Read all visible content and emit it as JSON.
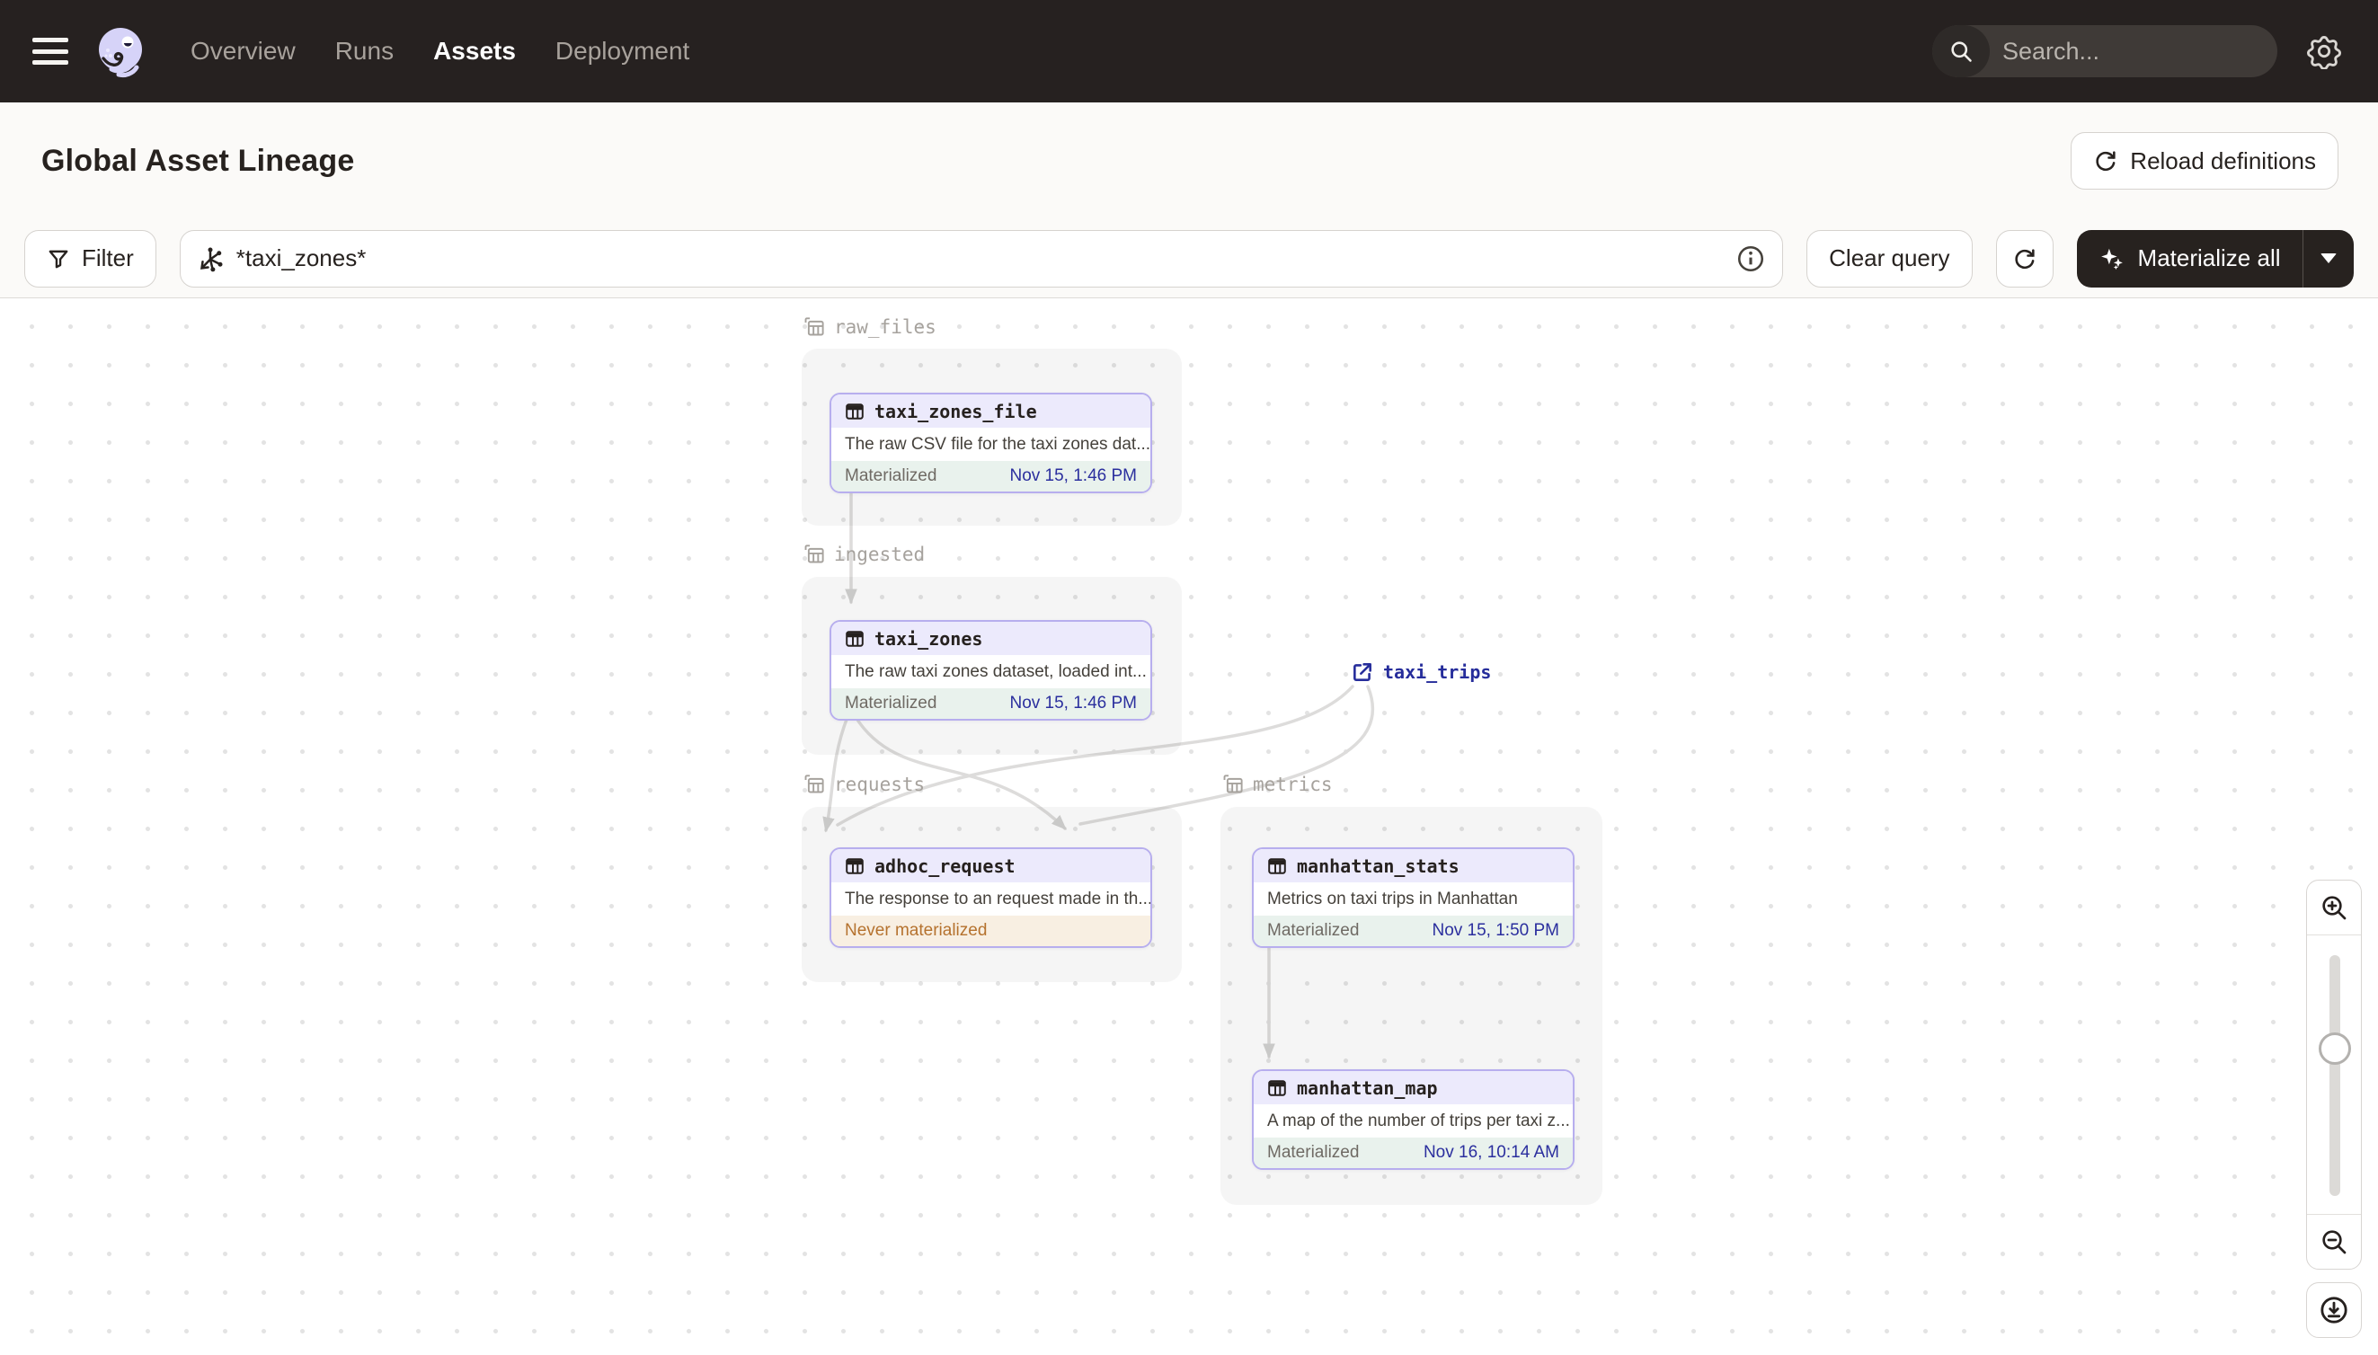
{
  "topnav": {
    "items": [
      {
        "label": "Overview",
        "active": false
      },
      {
        "label": "Runs",
        "active": false
      },
      {
        "label": "Assets",
        "active": true
      },
      {
        "label": "Deployment",
        "active": false
      }
    ],
    "search_placeholder": "Search...",
    "search_shortcut": "/"
  },
  "header": {
    "title": "Global Asset Lineage",
    "reload_button": "Reload definitions"
  },
  "toolbar": {
    "filter_label": "Filter",
    "query_value": "*taxi_zones*",
    "clear_query_label": "Clear query",
    "materialize_label": "Materialize all"
  },
  "graph": {
    "groups": [
      {
        "name": "raw_files"
      },
      {
        "name": "ingested"
      },
      {
        "name": "requests"
      },
      {
        "name": "metrics"
      }
    ],
    "nodes": [
      {
        "name": "taxi_zones_file",
        "description": "The raw CSV file for the taxi zones dat...",
        "status_label": "Materialized",
        "timestamp": "Nov 15, 1:46 PM"
      },
      {
        "name": "taxi_zones",
        "description": "The raw taxi zones dataset, loaded int...",
        "status_label": "Materialized",
        "timestamp": "Nov 15, 1:46 PM"
      },
      {
        "name": "adhoc_request",
        "description": "The response to an request made in th...",
        "status_label": "Never materialized",
        "timestamp": ""
      },
      {
        "name": "manhattan_stats",
        "description": "Metrics on taxi trips in Manhattan",
        "status_label": "Materialized",
        "timestamp": "Nov 15, 1:50 PM"
      },
      {
        "name": "manhattan_map",
        "description": "A map of the number of trips per taxi z...",
        "status_label": "Materialized",
        "timestamp": "Nov 16, 10:14 AM"
      }
    ],
    "external_asset": {
      "name": "taxi_trips"
    }
  },
  "colors": {
    "nav_bg": "#262120",
    "node_border": "#b7aeee",
    "node_header_bg": "#eceafc",
    "materialized_bg": "#e9f2ed",
    "timestamp_blue": "#2b2f9e",
    "never_materialized_bg": "#f8efe2",
    "never_materialized_text": "#b5722e",
    "external_link_blue": "#262d9b"
  }
}
